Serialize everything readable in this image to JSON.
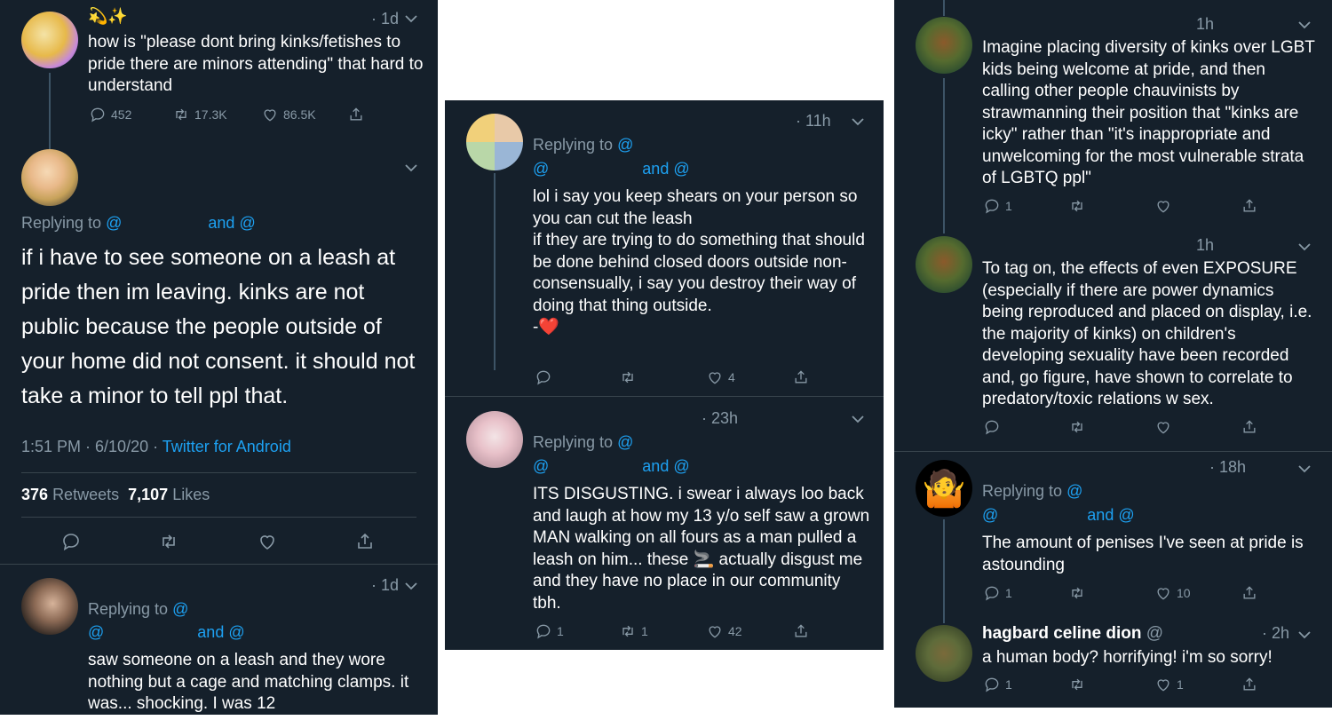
{
  "panel1": {
    "tweet1": {
      "emoji": "💫✨",
      "time": "· 1d",
      "text": "how is \"please dont bring kinks/fetishes to pride there are minors attending\" that hard to understand",
      "replies": "452",
      "retweets": "17.3K",
      "likes": "86.5K"
    },
    "tweet2": {
      "replying_prefix": "Replying to",
      "at1": "@",
      "and": "and",
      "at2": "@",
      "text": "if i have to see someone on a leash at pride then im leaving. kinks are not public because the people outside of your home did not consent. it should not take a minor to tell ppl that.",
      "datetime": "1:51 PM · 6/10/20 · ",
      "source": "Twitter for Android",
      "retweets_count": "376",
      "retweets_label": "Retweets",
      "likes_count": "7,107",
      "likes_label": "Likes"
    },
    "tweet3": {
      "time": "· 1d",
      "replying_prefix": "Replying to",
      "at1": "@",
      "at_line": "@",
      "and": "and",
      "at2": "@",
      "text": "saw someone on a leash and they wore nothing but a cage and matching clamps. it was... shocking. I was 12"
    }
  },
  "panel2": {
    "tweet1": {
      "time": "· 11h",
      "replying_prefix": "Replying to",
      "at1": "@",
      "at_line": "@",
      "and": "and",
      "at2": "@",
      "text": "lol i say you keep shears on your person so you can cut the leash\nif they are trying to do something that should be done behind closed doors outside non-consensually, i say you destroy their way of doing that thing outside.\n-❤️",
      "likes": "4"
    },
    "tweet2": {
      "time": "· 23h",
      "replying_prefix": "Replying to",
      "at1": "@",
      "at_line": "@",
      "and": "and",
      "at2": "@",
      "text_a": "ITS DISGUSTING. i swear i always loo back and laugh at how my 13 y/o self saw a grown MAN walking on all fours as a man pulled a leash on him... these ",
      "emoji": "🚬",
      "text_b": " actually disgust me and they have no place in our community tbh.",
      "replies": "1",
      "retweets": "1",
      "likes": "42"
    }
  },
  "panel3": {
    "tweet1": {
      "time": "1h",
      "text": "Imagine placing diversity of kinks over LGBT kids being welcome at pride, and then calling other people chauvinists by strawmanning their position that \"kinks are icky\" rather than \"it's inappropriate and unwelcoming for the most vulnerable strata of LGBTQ ppl\"",
      "replies": "1"
    },
    "tweet2": {
      "time": "1h",
      "text": "To tag on, the effects of even EXPOSURE (especially if there are power dynamics being reproduced and placed on display, i.e. the majority of kinks) on children's developing sexuality have been recorded and, go figure, have shown to correlate to predatory/toxic relations w sex."
    },
    "tweet3": {
      "time": "· 18h",
      "replying_prefix": "Replying to",
      "at1": "@",
      "at_line": "@",
      "and": "and",
      "at2": "@",
      "text": "The amount of penises I've seen at pride is astounding",
      "replies": "1",
      "likes": "10"
    },
    "tweet4": {
      "name": "hagbard celine dion",
      "handle": "@",
      "time": "· 2h",
      "text": "a human body? horrifying! i'm so sorry!",
      "replies": "1",
      "likes": "1"
    }
  },
  "colors": {
    "background": "#15202b",
    "text": "#ffffff",
    "muted": "#8899a6",
    "link": "#1da1f2",
    "divider": "#38444d"
  },
  "icons": [
    "reply-icon",
    "retweet-icon",
    "like-icon",
    "share-icon",
    "chevron-down-icon"
  ]
}
